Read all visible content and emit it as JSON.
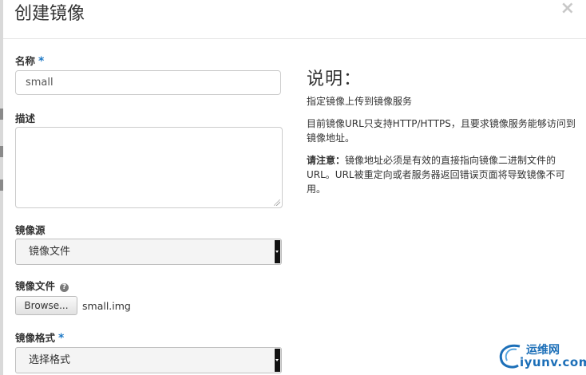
{
  "modal": {
    "title": "创建镜像",
    "close_symbol": "×"
  },
  "form": {
    "name_label": "名称",
    "name_required": "*",
    "name_value": "small",
    "description_label": "描述",
    "description_value": "",
    "image_source_label": "镜像源",
    "image_source_value": "镜像文件",
    "image_file_label": "镜像文件",
    "image_file_help": "?",
    "browse_label": "Browse...",
    "selected_file": "small.img",
    "format_label": "镜像格式",
    "format_required": "*",
    "format_value": "选择格式"
  },
  "description": {
    "title": "说明：",
    "line1": "指定镜像上传到镜像服务",
    "line2": "目前镜像URL只支持HTTP/HTTPS，且要求镜像服务能够访问到镜像地址。",
    "note_label": "请注意：",
    "note_text": "镜像地址必须是有效的直接指向镜像二进制文件的URL。URL被重定向或者服务器返回错误页面将导致镜像不可用。"
  },
  "watermark": {
    "cn": "运维网",
    "domain": "iyunv.com"
  },
  "colors": {
    "required": "#1f7ac6",
    "watermark": "#1c6fb8"
  }
}
